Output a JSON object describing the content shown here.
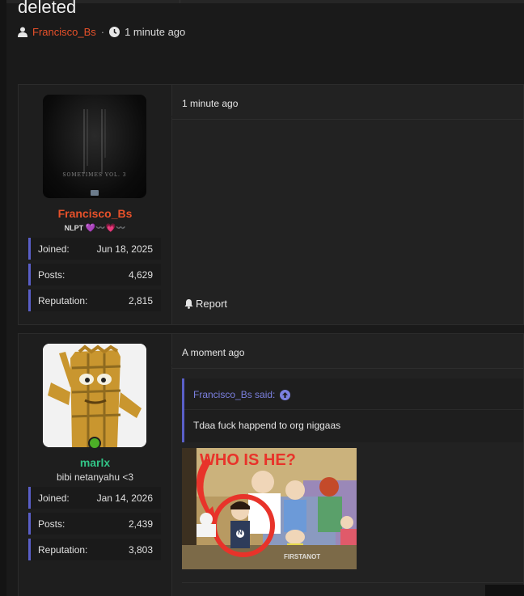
{
  "thread": {
    "title": "deleted",
    "author": "Francisco_Bs",
    "separator": "·",
    "time": "1 minute ago"
  },
  "posts": [
    {
      "username": "Francisco_Bs",
      "user_title": "NLPT",
      "user_title_emoji": "💜〰️💗〰️",
      "avatar_caption": "SOMETIMES VOL. 3",
      "stats": [
        {
          "label": "Joined:",
          "value": "Jun 18, 2025"
        },
        {
          "label": "Posts:",
          "value": "4,629"
        },
        {
          "label": "Reputation:",
          "value": "2,815"
        }
      ],
      "time": "1 minute ago",
      "report_label": "Report"
    },
    {
      "username": "marlx",
      "user_title": "bibi netanyahu <3",
      "stats": [
        {
          "label": "Joined:",
          "value": "Jan 14, 2026"
        },
        {
          "label": "Posts:",
          "value": "2,439"
        },
        {
          "label": "Reputation:",
          "value": "3,803"
        }
      ],
      "time": "A moment ago",
      "quote": {
        "author_said": "Francisco_Bs said:",
        "text": "Tdaa fuck happend to org niggaas"
      },
      "image": {
        "headline": "WHO IS HE?",
        "watermark": "FIRSTANOT"
      }
    }
  ],
  "colors": {
    "author_accent": "#e8512a",
    "online_user": "#32c487",
    "stat_accent": "#5a5fc8",
    "quote_link": "#7b80e0",
    "online_dot": "#4caf27"
  }
}
